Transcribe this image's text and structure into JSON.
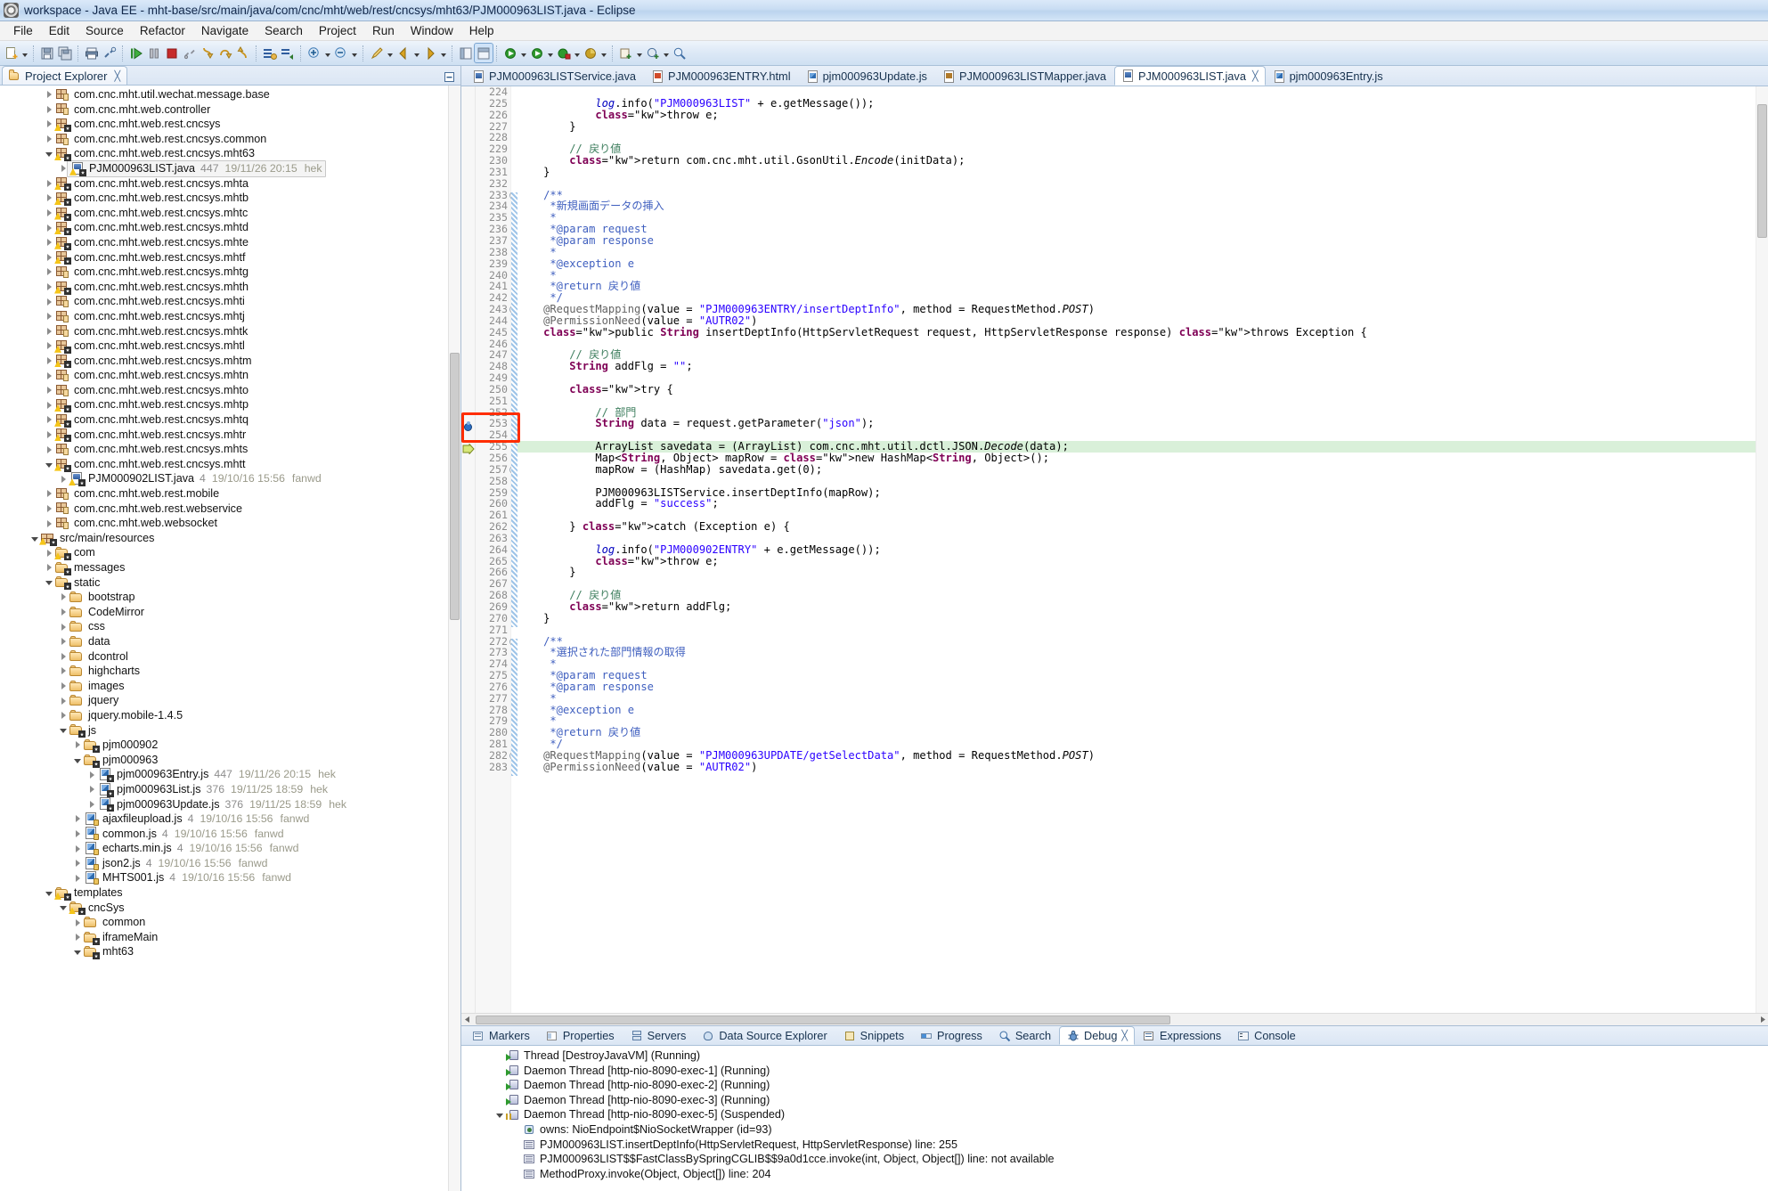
{
  "window": {
    "title": "workspace - Java EE - mht-base/src/main/java/com/cnc/mht/web/rest/cncsys/mht63/PJM000963LIST.java - Eclipse",
    "icon": "eclipse-icon"
  },
  "menubar": {
    "items": [
      "File",
      "Edit",
      "Source",
      "Refactor",
      "Navigate",
      "Search",
      "Project",
      "Run",
      "Window",
      "Help"
    ]
  },
  "toolbar": {
    "groups": [
      [
        "new-wizard-icon",
        "dropdown-arrow"
      ],
      [
        "save-icon",
        "save-all-icon"
      ],
      [
        "print-icon",
        "link-icon"
      ],
      [
        "resume-icon",
        "suspend-icon",
        "terminate-icon",
        "disconnect-icon",
        "step-into-icon",
        "step-over-icon",
        "step-return-icon"
      ],
      [
        "open-type-icon",
        "open-task-icon"
      ],
      [
        "next-annotation-icon",
        "previous-annotation-icon"
      ],
      [
        "last-edit-location-icon",
        "back-icon",
        "forward-icon"
      ],
      [
        "java-perspective-icon",
        "javaee-perspective-icon"
      ],
      [
        "debug-dropdown-icon",
        "run-dropdown-icon",
        "run-external-icon",
        "coverage-icon"
      ],
      [
        "new-java-project-icon",
        "new-class-icon",
        "search-icon"
      ]
    ]
  },
  "project_explorer": {
    "tab_label": "Project Explorer",
    "close_glyph": "╳",
    "toolbar_icons": [
      "collapse-all-icon",
      "link-with-editor-icon",
      "view-menu-icon",
      "minimize-icon",
      "maximize-icon"
    ],
    "tree": [
      {
        "indent": 3,
        "twist": "closed",
        "icon": "package",
        "label": "com.cnc.mht.util.wechat.message.base"
      },
      {
        "indent": 3,
        "twist": "closed",
        "icon": "package",
        "label": "com.cnc.mht.web.controller"
      },
      {
        "indent": 3,
        "twist": "closed",
        "icon": "package-warn",
        "label": "com.cnc.mht.web.rest.cncsys"
      },
      {
        "indent": 3,
        "twist": "closed",
        "icon": "package",
        "label": "com.cnc.mht.web.rest.cncsys.common"
      },
      {
        "indent": 3,
        "twist": "open",
        "icon": "package-warn",
        "label": "com.cnc.mht.web.rest.cncsys.mht63"
      },
      {
        "indent": 4,
        "twist": "closed",
        "icon": "java-warn",
        "label": "PJM000963LIST.java",
        "rev": "447",
        "date": "19/11/26 20:15",
        "author": "hek",
        "selected": true
      },
      {
        "indent": 3,
        "twist": "closed",
        "icon": "package-warn",
        "label": "com.cnc.mht.web.rest.cncsys.mhta"
      },
      {
        "indent": 3,
        "twist": "closed",
        "icon": "package-warn",
        "label": "com.cnc.mht.web.rest.cncsys.mhtb"
      },
      {
        "indent": 3,
        "twist": "closed",
        "icon": "package-warn",
        "label": "com.cnc.mht.web.rest.cncsys.mhtc"
      },
      {
        "indent": 3,
        "twist": "closed",
        "icon": "package-warn",
        "label": "com.cnc.mht.web.rest.cncsys.mhtd"
      },
      {
        "indent": 3,
        "twist": "closed",
        "icon": "package-warn",
        "label": "com.cnc.mht.web.rest.cncsys.mhte"
      },
      {
        "indent": 3,
        "twist": "closed",
        "icon": "package-warn",
        "label": "com.cnc.mht.web.rest.cncsys.mhtf"
      },
      {
        "indent": 3,
        "twist": "closed",
        "icon": "package",
        "label": "com.cnc.mht.web.rest.cncsys.mhtg"
      },
      {
        "indent": 3,
        "twist": "closed",
        "icon": "package-warn",
        "label": "com.cnc.mht.web.rest.cncsys.mhth"
      },
      {
        "indent": 3,
        "twist": "closed",
        "icon": "package",
        "label": "com.cnc.mht.web.rest.cncsys.mhti"
      },
      {
        "indent": 3,
        "twist": "closed",
        "icon": "package",
        "label": "com.cnc.mht.web.rest.cncsys.mhtj"
      },
      {
        "indent": 3,
        "twist": "closed",
        "icon": "package",
        "label": "com.cnc.mht.web.rest.cncsys.mhtk"
      },
      {
        "indent": 3,
        "twist": "closed",
        "icon": "package-warn",
        "label": "com.cnc.mht.web.rest.cncsys.mhtl"
      },
      {
        "indent": 3,
        "twist": "closed",
        "icon": "package-warn",
        "label": "com.cnc.mht.web.rest.cncsys.mhtm"
      },
      {
        "indent": 3,
        "twist": "closed",
        "icon": "package",
        "label": "com.cnc.mht.web.rest.cncsys.mhtn"
      },
      {
        "indent": 3,
        "twist": "closed",
        "icon": "package",
        "label": "com.cnc.mht.web.rest.cncsys.mhto"
      },
      {
        "indent": 3,
        "twist": "closed",
        "icon": "package-warn",
        "label": "com.cnc.mht.web.rest.cncsys.mhtp"
      },
      {
        "indent": 3,
        "twist": "closed",
        "icon": "package-warn",
        "label": "com.cnc.mht.web.rest.cncsys.mhtq"
      },
      {
        "indent": 3,
        "twist": "closed",
        "icon": "package-warn",
        "label": "com.cnc.mht.web.rest.cncsys.mhtr"
      },
      {
        "indent": 3,
        "twist": "closed",
        "icon": "package",
        "label": "com.cnc.mht.web.rest.cncsys.mhts"
      },
      {
        "indent": 3,
        "twist": "open",
        "icon": "package-warn",
        "label": "com.cnc.mht.web.rest.cncsys.mhtt"
      },
      {
        "indent": 4,
        "twist": "closed",
        "icon": "java-warn",
        "label": "PJM000902LIST.java",
        "rev": "4",
        "date": "19/10/16 15:56",
        "author": "fanwd"
      },
      {
        "indent": 3,
        "twist": "closed",
        "icon": "package",
        "label": "com.cnc.mht.web.rest.mobile"
      },
      {
        "indent": 3,
        "twist": "closed",
        "icon": "package",
        "label": "com.cnc.mht.web.rest.webservice"
      },
      {
        "indent": 3,
        "twist": "closed",
        "icon": "package",
        "label": "com.cnc.mht.web.websocket"
      },
      {
        "indent": 2,
        "twist": "open",
        "icon": "srcfolder-warn",
        "label": "src/main/resources"
      },
      {
        "indent": 3,
        "twist": "closed",
        "icon": "folder-warn",
        "label": "com"
      },
      {
        "indent": 3,
        "twist": "closed",
        "icon": "folder-star",
        "label": "messages"
      },
      {
        "indent": 3,
        "twist": "open",
        "icon": "folder-star",
        "label": "static"
      },
      {
        "indent": 4,
        "twist": "closed",
        "icon": "folder",
        "label": "bootstrap"
      },
      {
        "indent": 4,
        "twist": "closed",
        "icon": "folder",
        "label": "CodeMirror"
      },
      {
        "indent": 4,
        "twist": "closed",
        "icon": "folder",
        "label": "css"
      },
      {
        "indent": 4,
        "twist": "closed",
        "icon": "folder",
        "label": "data"
      },
      {
        "indent": 4,
        "twist": "closed",
        "icon": "folder",
        "label": "dcontrol"
      },
      {
        "indent": 4,
        "twist": "closed",
        "icon": "folder",
        "label": "highcharts"
      },
      {
        "indent": 4,
        "twist": "closed",
        "icon": "folder",
        "label": "images"
      },
      {
        "indent": 4,
        "twist": "closed",
        "icon": "folder",
        "label": "jquery"
      },
      {
        "indent": 4,
        "twist": "closed",
        "icon": "folder",
        "label": "jquery.mobile-1.4.5"
      },
      {
        "indent": 4,
        "twist": "open",
        "icon": "folder-star",
        "label": "js"
      },
      {
        "indent": 5,
        "twist": "closed",
        "icon": "folder-star",
        "label": "pjm000902"
      },
      {
        "indent": 5,
        "twist": "open",
        "icon": "folder-star",
        "label": "pjm000963"
      },
      {
        "indent": 6,
        "twist": "closed",
        "icon": "jsfile-star",
        "label": "pjm000963Entry.js",
        "rev": "447",
        "date": "19/11/26 20:15",
        "author": "hek"
      },
      {
        "indent": 6,
        "twist": "closed",
        "icon": "jsfile-star",
        "label": "pjm000963List.js",
        "rev": "376",
        "date": "19/11/25 18:59",
        "author": "hek"
      },
      {
        "indent": 6,
        "twist": "closed",
        "icon": "jsfile-star",
        "label": "pjm000963Update.js",
        "rev": "376",
        "date": "19/11/25 18:59",
        "author": "hek"
      },
      {
        "indent": 5,
        "twist": "closed",
        "icon": "jsfile",
        "label": "ajaxfileupload.js",
        "rev": "4",
        "date": "19/10/16 15:56",
        "author": "fanwd"
      },
      {
        "indent": 5,
        "twist": "closed",
        "icon": "jsfile",
        "label": "common.js",
        "rev": "4",
        "date": "19/10/16 15:56",
        "author": "fanwd"
      },
      {
        "indent": 5,
        "twist": "closed",
        "icon": "jsfile",
        "label": "echarts.min.js",
        "rev": "4",
        "date": "19/10/16 15:56",
        "author": "fanwd"
      },
      {
        "indent": 5,
        "twist": "closed",
        "icon": "jsfile",
        "label": "json2.js",
        "rev": "4",
        "date": "19/10/16 15:56",
        "author": "fanwd"
      },
      {
        "indent": 5,
        "twist": "closed",
        "icon": "jsfile",
        "label": "MHTS001.js",
        "rev": "4",
        "date": "19/10/16 15:56",
        "author": "fanwd"
      },
      {
        "indent": 3,
        "twist": "open",
        "icon": "folder-warn",
        "label": "templates"
      },
      {
        "indent": 4,
        "twist": "open",
        "icon": "folder-warn",
        "label": "cncSys"
      },
      {
        "indent": 5,
        "twist": "closed",
        "icon": "folder",
        "label": "common"
      },
      {
        "indent": 5,
        "twist": "closed",
        "icon": "folder-star",
        "label": "iframeMain"
      },
      {
        "indent": 5,
        "twist": "open",
        "icon": "folder-star",
        "label": "mht63"
      }
    ]
  },
  "editor": {
    "tabs": [
      {
        "label": "PJM000963LISTService.java",
        "type": "java",
        "active": false,
        "closable": false
      },
      {
        "label": "PJM000963ENTRY.html",
        "type": "html",
        "active": false,
        "closable": false
      },
      {
        "label": "pjm000963Update.js",
        "type": "js",
        "active": false,
        "closable": false
      },
      {
        "label": "PJM000963LISTMapper.java",
        "type": "xml",
        "active": false,
        "closable": false
      },
      {
        "label": "PJM000963LIST.java",
        "type": "java",
        "active": true,
        "closable": true
      },
      {
        "label": "pjm000963Entry.js",
        "type": "js",
        "active": false,
        "closable": false
      }
    ],
    "first_line": 224,
    "lines": [
      {
        "n": 224,
        "text": "",
        "fold": false
      },
      {
        "n": 225,
        "text": "            log.info(\"PJM000963LIST\" + e.getMessage());",
        "fold": false
      },
      {
        "n": 226,
        "text": "            throw e;",
        "fold": false
      },
      {
        "n": 227,
        "text": "        }",
        "fold": false
      },
      {
        "n": 228,
        "text": "",
        "fold": false
      },
      {
        "n": 229,
        "text": "        // 戻り値",
        "fold": false
      },
      {
        "n": 230,
        "text": "        return com.cnc.mht.util.GsonUtil.Encode(initData);",
        "fold": false
      },
      {
        "n": 231,
        "text": "    }",
        "fold": false
      },
      {
        "n": 232,
        "text": "",
        "fold": false
      },
      {
        "n": 233,
        "text": "    /**",
        "fold": true
      },
      {
        "n": 234,
        "text": "     *新規画面データの挿入",
        "fold": false
      },
      {
        "n": 235,
        "text": "     *",
        "fold": false
      },
      {
        "n": 236,
        "text": "     *@param request",
        "fold": false
      },
      {
        "n": 237,
        "text": "     *@param response",
        "fold": false
      },
      {
        "n": 238,
        "text": "     *",
        "fold": false
      },
      {
        "n": 239,
        "text": "     *@exception e",
        "fold": false
      },
      {
        "n": 240,
        "text": "     *",
        "fold": false
      },
      {
        "n": 241,
        "text": "     *@return 戻り値",
        "fold": false
      },
      {
        "n": 242,
        "text": "     */",
        "fold": false
      },
      {
        "n": 243,
        "text": "    @RequestMapping(value = \"PJM000963ENTRY/insertDeptInfo\", method = RequestMethod.POST)",
        "fold": true
      },
      {
        "n": 244,
        "text": "    @PermissionNeed(value = \"AUTR02\")",
        "fold": false
      },
      {
        "n": 245,
        "text": "    public String insertDeptInfo(HttpServletRequest request, HttpServletResponse response) throws Exception {",
        "fold": false
      },
      {
        "n": 246,
        "text": "",
        "fold": false
      },
      {
        "n": 247,
        "text": "        // 戻り値",
        "fold": false
      },
      {
        "n": 248,
        "text": "        String addFlg = \"\";",
        "fold": false
      },
      {
        "n": 249,
        "text": "",
        "fold": false
      },
      {
        "n": 250,
        "text": "        try {",
        "fold": false
      },
      {
        "n": 251,
        "text": "",
        "fold": false
      },
      {
        "n": 252,
        "text": "            // 部門",
        "fold": false
      },
      {
        "n": 253,
        "text": "            String data = request.getParameter(\"json\");",
        "fold": false
      },
      {
        "n": 254,
        "text": "",
        "fold": false
      },
      {
        "n": 255,
        "text": "            ArrayList savedata = (ArrayList) com.cnc.mht.util.dctl.JSON.Decode(data);",
        "fold": false
      },
      {
        "n": 256,
        "text": "            Map<String, Object> mapRow = new HashMap<String, Object>();",
        "fold": false
      },
      {
        "n": 257,
        "text": "            mapRow = (HashMap) savedata.get(0);",
        "fold": true
      },
      {
        "n": 258,
        "text": "",
        "fold": false
      },
      {
        "n": 259,
        "text": "            PJM000963LISTService.insertDeptInfo(mapRow);",
        "fold": false
      },
      {
        "n": 260,
        "text": "            addFlg = \"success\";",
        "fold": false
      },
      {
        "n": 261,
        "text": "",
        "fold": false
      },
      {
        "n": 262,
        "text": "        } catch (Exception e) {",
        "fold": false
      },
      {
        "n": 263,
        "text": "",
        "fold": false
      },
      {
        "n": 264,
        "text": "            log.info(\"PJM000902ENTRY\" + e.getMessage());",
        "fold": false
      },
      {
        "n": 265,
        "text": "            throw e;",
        "fold": false
      },
      {
        "n": 266,
        "text": "        }",
        "fold": false
      },
      {
        "n": 267,
        "text": "",
        "fold": false
      },
      {
        "n": 268,
        "text": "        // 戻り値",
        "fold": false
      },
      {
        "n": 269,
        "text": "        return addFlg;",
        "fold": false
      },
      {
        "n": 270,
        "text": "    }",
        "fold": false
      },
      {
        "n": 271,
        "text": "",
        "fold": false
      },
      {
        "n": 272,
        "text": "    /**",
        "fold": true
      },
      {
        "n": 273,
        "text": "     *選択された部門情報の取得",
        "fold": false
      },
      {
        "n": 274,
        "text": "     *",
        "fold": false
      },
      {
        "n": 275,
        "text": "     *@param request",
        "fold": false
      },
      {
        "n": 276,
        "text": "     *@param response",
        "fold": false
      },
      {
        "n": 277,
        "text": "     *",
        "fold": false
      },
      {
        "n": 278,
        "text": "     *@exception e",
        "fold": false
      },
      {
        "n": 279,
        "text": "     *",
        "fold": false
      },
      {
        "n": 280,
        "text": "     *@return 戻り値",
        "fold": false
      },
      {
        "n": 281,
        "text": "     */",
        "fold": false
      },
      {
        "n": 282,
        "text": "    @RequestMapping(value = \"PJM000963UPDATE/getSelectData\", method = RequestMethod.POST)",
        "fold": true
      },
      {
        "n": 283,
        "text": "    @PermissionNeed(value = \"AUTR02\")",
        "fold": false
      }
    ],
    "breakpoint_line": 253,
    "execution_line": 255,
    "annotation_box_color": "#ff2d00"
  },
  "bottom_panel": {
    "tabs": [
      {
        "label": "Markers",
        "icon": "markers-icon",
        "active": false
      },
      {
        "label": "Properties",
        "icon": "properties-icon",
        "active": false
      },
      {
        "label": "Servers",
        "icon": "servers-icon",
        "active": false
      },
      {
        "label": "Data Source Explorer",
        "icon": "datasource-icon",
        "active": false
      },
      {
        "label": "Snippets",
        "icon": "snippets-icon",
        "active": false
      },
      {
        "label": "Progress",
        "icon": "progress-icon",
        "active": false
      },
      {
        "label": "Search",
        "icon": "search-icon",
        "active": false
      },
      {
        "label": "Debug",
        "icon": "debug-icon",
        "active": true,
        "close_glyph": "╳"
      },
      {
        "label": "Expressions",
        "icon": "expressions-icon",
        "active": false
      },
      {
        "label": "Console",
        "icon": "console-icon",
        "active": false
      }
    ],
    "debug_tree": [
      {
        "indent": 1,
        "twist": "none",
        "icon": "thread-running",
        "label": "Thread [DestroyJavaVM] (Running)"
      },
      {
        "indent": 1,
        "twist": "none",
        "icon": "thread-running",
        "label": "Daemon Thread [http-nio-8090-exec-1] (Running)"
      },
      {
        "indent": 1,
        "twist": "none",
        "icon": "thread-running",
        "label": "Daemon Thread [http-nio-8090-exec-2] (Running)"
      },
      {
        "indent": 1,
        "twist": "none",
        "icon": "thread-running",
        "label": "Daemon Thread [http-nio-8090-exec-3] (Running)"
      },
      {
        "indent": 1,
        "twist": "open",
        "icon": "thread-suspended",
        "label": "Daemon Thread [http-nio-8090-exec-5] (Suspended)"
      },
      {
        "indent": 2,
        "twist": "none",
        "icon": "monitor",
        "label": "owns: NioEndpoint$NioSocketWrapper  (id=93)"
      },
      {
        "indent": 2,
        "twist": "none",
        "icon": "frame",
        "label": "PJM000963LIST.insertDeptInfo(HttpServletRequest, HttpServletResponse) line: 255"
      },
      {
        "indent": 2,
        "twist": "none",
        "icon": "frame",
        "label": "PJM000963LIST$$FastClassBySpringCGLIB$$9a0d1cce.invoke(int, Object, Object[]) line: not available"
      },
      {
        "indent": 2,
        "twist": "none",
        "icon": "frame",
        "label": "MethodProxy.invoke(Object, Object[]) line: 204"
      }
    ]
  }
}
